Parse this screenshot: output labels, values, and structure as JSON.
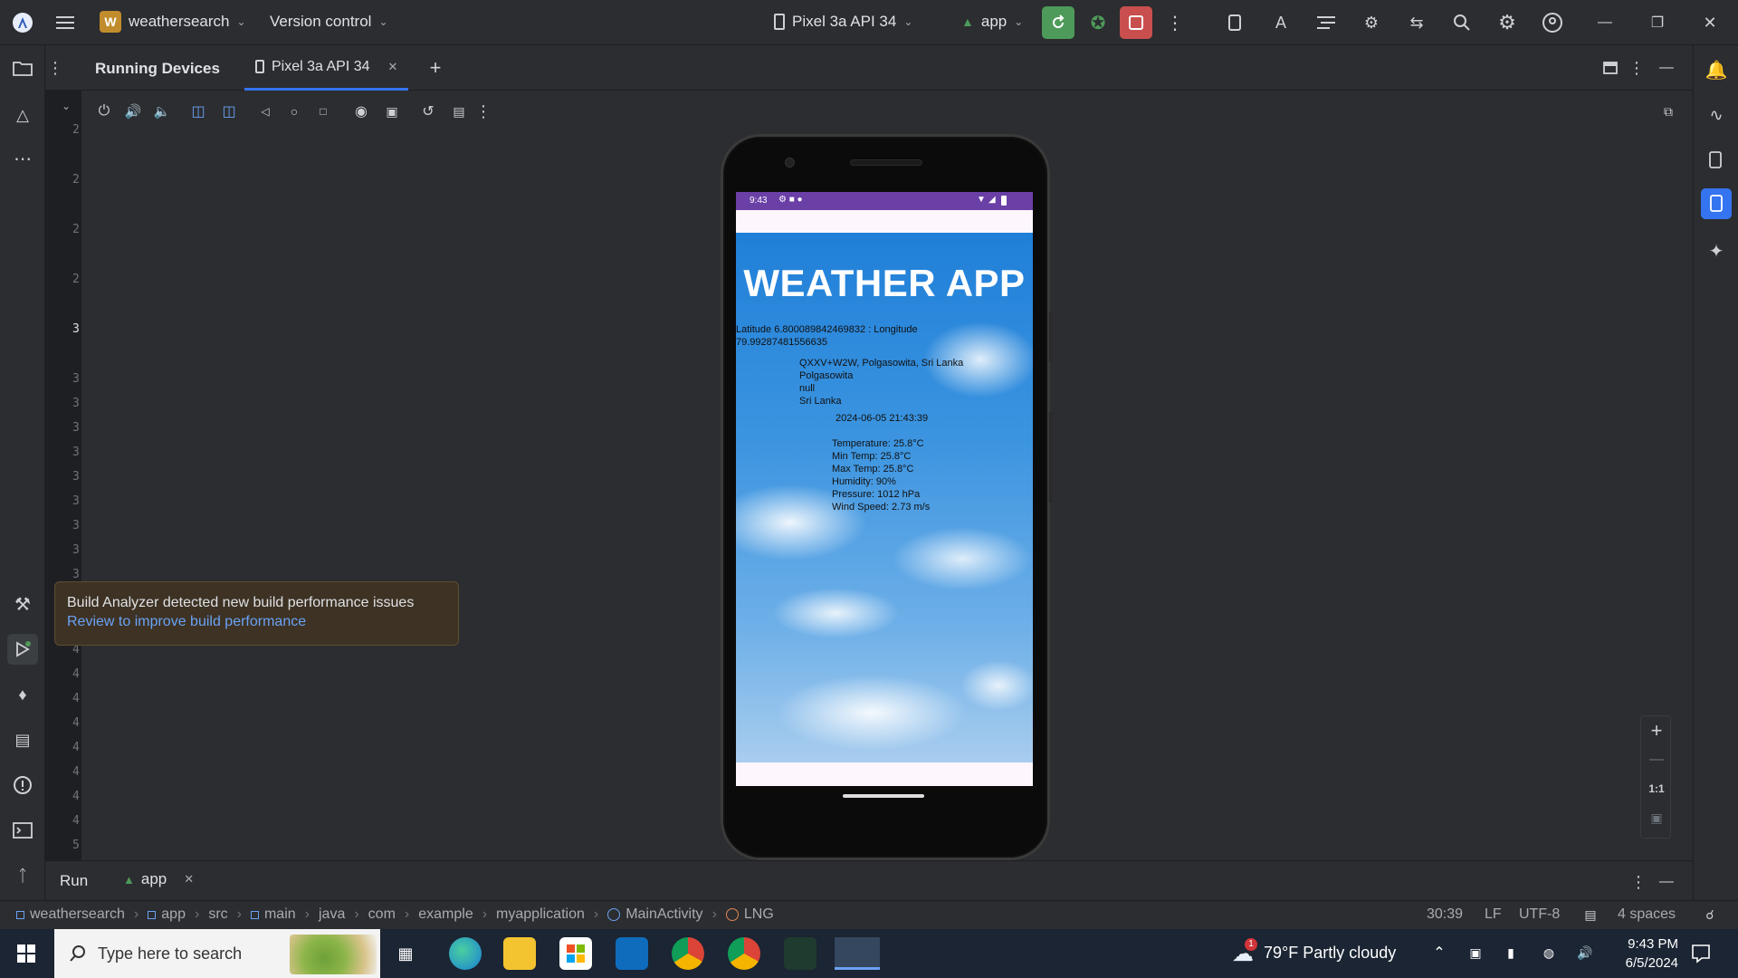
{
  "titlebar": {
    "project_badge": "W",
    "project_name": "weathersearch",
    "vcs": "Version control",
    "device": "Pixel 3a API 34",
    "run_config": "app"
  },
  "panel": {
    "title": "Running Devices",
    "tab_label": "Pixel 3a API 34"
  },
  "gutter_numbers": [
    "2",
    "2",
    "2",
    "2",
    "3",
    "3",
    "3",
    "3",
    "3",
    "3",
    "3",
    "3",
    "3",
    "3",
    "4",
    "4",
    "4",
    "4",
    "4",
    "4",
    "4",
    "4",
    "5"
  ],
  "phone": {
    "status_time": "9:43",
    "app_title": "WEATHER APP",
    "lat_lng": "Latitude 6.800089842469832 : Longitude 79.99287481556635",
    "address_lines": [
      "QXXV+W2W, Polgasowita, Sri Lanka",
      "Polgasowita",
      "null",
      "Sri Lanka"
    ],
    "datetime": "2024-06-05 21:43:39",
    "weather_lines": [
      "Temperature: 25.8°C",
      "Min Temp: 25.8°C",
      "Max Temp: 25.8°C",
      "Humidity: 90%",
      "Pressure: 1012 hPa",
      "Wind Speed: 2.73 m/s"
    ]
  },
  "tooltip": {
    "line1": "Build Analyzer detected new build performance issues",
    "link": "Review to improve build performance"
  },
  "zoom": {
    "ratio_label": "1:1"
  },
  "runbar": {
    "run_label": "Run",
    "app_tab": "app"
  },
  "breadcrumb": [
    "weathersearch",
    "app",
    "src",
    "main",
    "java",
    "com",
    "example",
    "myapplication",
    "MainActivity",
    "LNG"
  ],
  "status": {
    "position": "30:39",
    "line_sep": "LF",
    "encoding": "UTF-8",
    "indent": "4 spaces"
  },
  "taskbar": {
    "search_placeholder": "Type here to search",
    "weather": "79°F  Partly cloudy",
    "weather_badge": "1",
    "time": "9:43 PM",
    "date": "6/5/2024"
  },
  "colors": {
    "accent_blue": "#3574f0",
    "run_green": "#4e9a5a",
    "stop_red": "#c94f4f",
    "status_purple": "#6a3fa6"
  }
}
